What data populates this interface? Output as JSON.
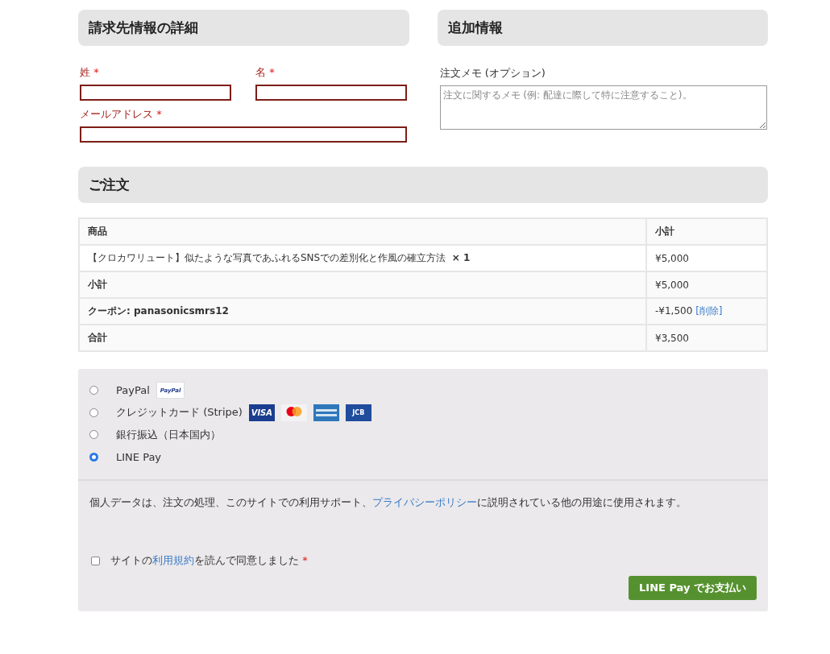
{
  "billing": {
    "title": "請求先情報の詳細",
    "fields": [
      {
        "label": "姓",
        "required_mark": "*",
        "kind": "half"
      },
      {
        "label": "名",
        "required_mark": "*",
        "kind": "half"
      },
      {
        "label": "メールアドレス",
        "required_mark": "*",
        "kind": "full"
      }
    ]
  },
  "additional": {
    "title": "追加情報",
    "label": "注文メモ (オプション)",
    "placeholder": "注文に関するメモ (例: 配達に際して特に注意すること)。"
  },
  "order": {
    "title": "ご注文",
    "columns": [
      "商品",
      "小計"
    ],
    "rows": [
      {
        "kind": "item",
        "label": "【クロカワリュート】似たような写真であふれるSNSでの差別化と作風の確立方法",
        "quantity": "× 1",
        "amount": "¥5,000"
      },
      {
        "kind": "subtotal",
        "label": "小計",
        "amount": "¥5,000"
      },
      {
        "kind": "coupon",
        "label": "クーポン: panasonicsmrs12",
        "amount": "-¥1,500",
        "remove": "[削除]"
      },
      {
        "kind": "total",
        "label": "合計",
        "amount": "¥3,500"
      }
    ]
  },
  "payment": {
    "methods": [
      {
        "label": "PayPal",
        "selected": false,
        "logos": [
          {
            "kind": "paypal",
            "text": "PayPal"
          }
        ]
      },
      {
        "label": "クレジットカード (Stripe)",
        "selected": false,
        "logos": [
          {
            "kind": "visa",
            "text": "VISA"
          },
          {
            "kind": "mastercard"
          },
          {
            "kind": "amex"
          },
          {
            "kind": "jcb",
            "text": "JCB"
          }
        ]
      },
      {
        "label": "銀行振込（日本国内）",
        "selected": false
      },
      {
        "label": "LINE Pay",
        "selected": true
      }
    ],
    "notice": {
      "before": "個人データは、注文の処理、このサイトでの利用サポート、",
      "link": "プライバシーポリシー",
      "after": "に説明されている他の用途に使用されます。"
    },
    "terms": {
      "checked": false,
      "before": "サイトの",
      "link": "利用規約",
      "after": "を読んで同意しました",
      "required_mark": "*"
    },
    "button": "LINE Pay でお支払い"
  }
}
